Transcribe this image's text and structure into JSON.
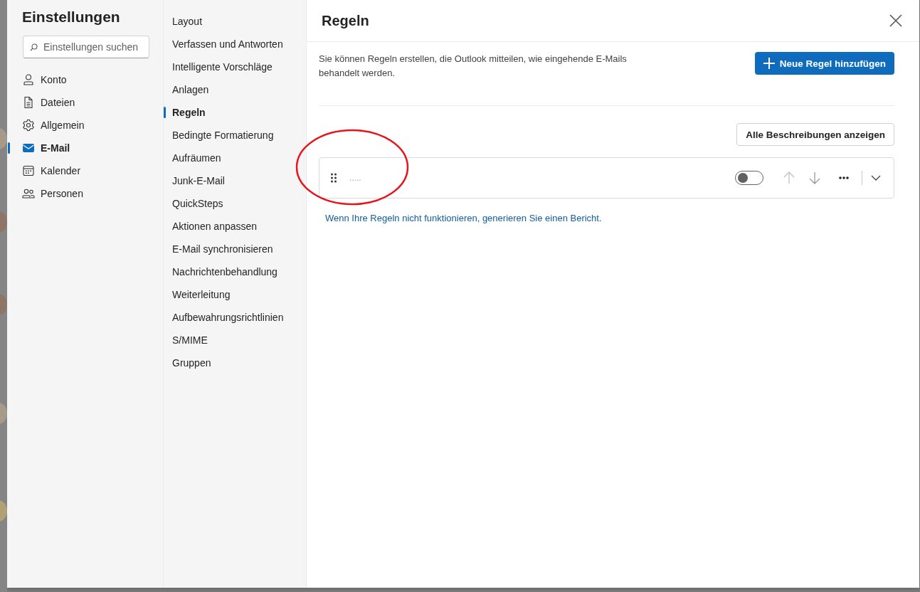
{
  "dialog": {
    "title": "Einstellungen",
    "search": {
      "placeholder": "Einstellungen suchen"
    },
    "categories": [
      {
        "label": "Konto",
        "selected": false
      },
      {
        "label": "Dateien",
        "selected": false
      },
      {
        "label": "Allgemein",
        "selected": false
      },
      {
        "label": "E-Mail",
        "selected": true
      },
      {
        "label": "Kalender",
        "selected": false
      },
      {
        "label": "Personen",
        "selected": false
      }
    ],
    "subcategories": [
      {
        "label": "Layout",
        "selected": false
      },
      {
        "label": "Verfassen und Antworten",
        "selected": false
      },
      {
        "label": "Intelligente Vorschläge",
        "selected": false
      },
      {
        "label": "Anlagen",
        "selected": false
      },
      {
        "label": "Regeln",
        "selected": true
      },
      {
        "label": "Bedingte Formatierung",
        "selected": false
      },
      {
        "label": "Aufräumen",
        "selected": false
      },
      {
        "label": "Junk-E-Mail",
        "selected": false
      },
      {
        "label": "QuickSteps",
        "selected": false
      },
      {
        "label": "Aktionen anpassen",
        "selected": false
      },
      {
        "label": "E-Mail synchronisieren",
        "selected": false
      },
      {
        "label": "Nachrichtenbehandlung",
        "selected": false
      },
      {
        "label": "Weiterleitung",
        "selected": false
      },
      {
        "label": "Aufbewahrungsrichtlinien",
        "selected": false
      },
      {
        "label": "S/MIME",
        "selected": false
      },
      {
        "label": "Gruppen",
        "selected": false
      }
    ],
    "panel": {
      "title": "Regeln",
      "description": "Sie können Regeln erstellen, die Outlook mitteilen, wie eingehende E-Mails behandelt werden.",
      "new_rule_button": "Neue Regel hinzufügen",
      "show_all_button": "Alle Beschreibungen anzeigen",
      "rules": [
        {
          "name": ".....",
          "on": false
        }
      ],
      "report_link": "Wenn Ihre Regeln nicht funktionieren, generieren Sie einen Bericht."
    }
  }
}
